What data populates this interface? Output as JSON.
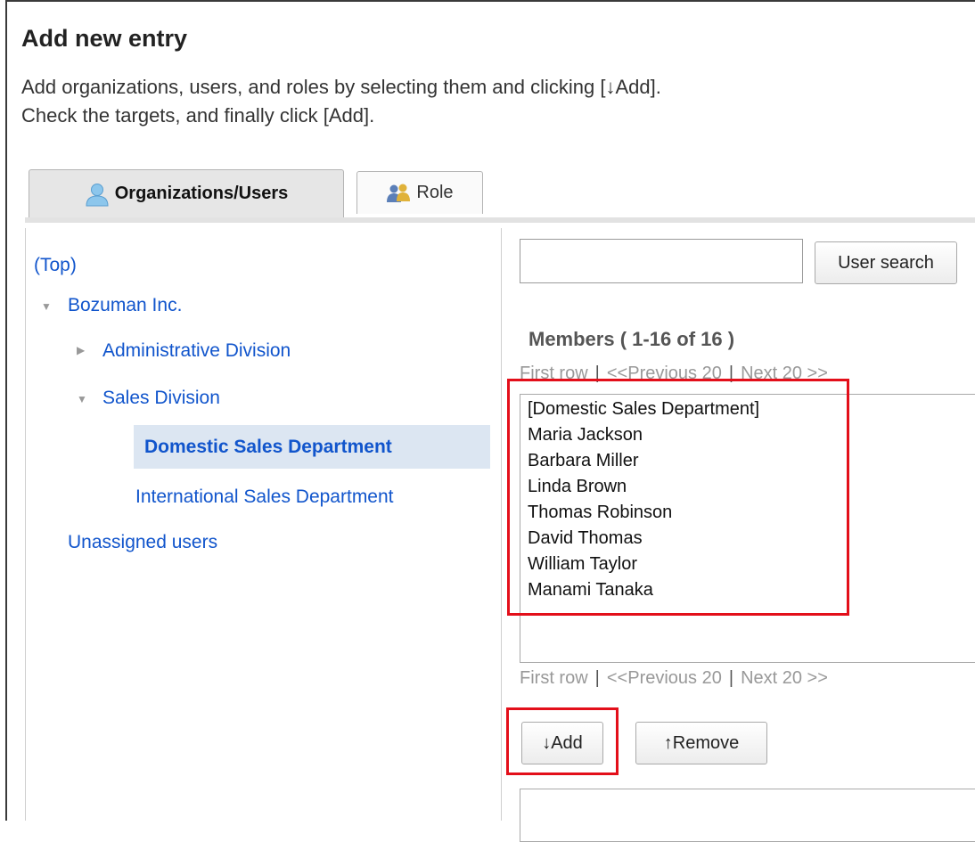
{
  "page": {
    "title": "Add new entry",
    "description_line1": "Add organizations, users, and roles by selecting them and clicking [↓Add].",
    "description_line2": "Check the targets, and finally click [Add]."
  },
  "tabs": [
    {
      "label": "Organizations/Users",
      "icon": "user-icon",
      "active": true
    },
    {
      "label": "Role",
      "icon": "role-users-icon",
      "active": false
    }
  ],
  "tree": {
    "top": "(Top)",
    "company": "Bozuman Inc.",
    "admin_division": "Administrative Division",
    "sales_division": "Sales Division",
    "domestic_sales": "Domestic Sales Department",
    "international_sales": "International Sales Department",
    "unassigned": "Unassigned users"
  },
  "search": {
    "value": "",
    "button_label": "User search"
  },
  "members": {
    "heading": "Members ( 1-16 of 16 )",
    "items": [
      "[Domestic Sales Department]",
      "Maria Jackson",
      "Barbara Miller",
      "Linda Brown",
      "Thomas Robinson",
      "David Thomas",
      "William Taylor",
      "Manami Tanaka"
    ]
  },
  "pager": {
    "first": "First row",
    "previous": "<<Previous 20",
    "next": "Next 20 >>"
  },
  "actions": {
    "add_label": "↓Add",
    "remove_label": "↑Remove"
  },
  "colors": {
    "link": "#1155cc",
    "highlight": "#e30f1a",
    "selected_bg": "#dce6f2"
  }
}
